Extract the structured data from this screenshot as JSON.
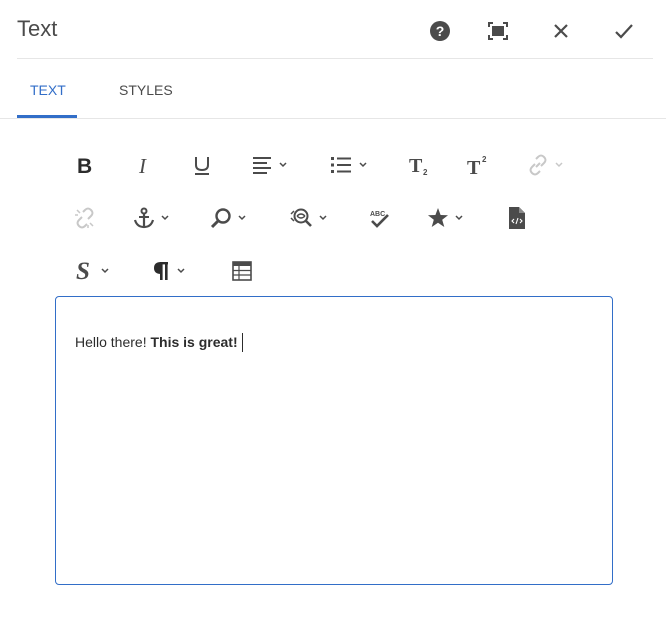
{
  "dialog": {
    "title": "Text",
    "help_icon": "help-icon",
    "fullscreen_icon": "fullscreen-icon",
    "close_icon": "close-icon",
    "confirm_icon": "checkmark-icon"
  },
  "tabs": [
    {
      "label": "TEXT",
      "active": true
    },
    {
      "label": "STYLES",
      "active": false
    }
  ],
  "toolbar": {
    "row1": [
      "bold",
      "italic",
      "underline",
      "align",
      "list",
      "subscript",
      "superscript",
      "link"
    ],
    "row2": [
      "unlink",
      "anchor",
      "find",
      "find-replace",
      "spellcheck",
      "special-characters",
      "source-edit"
    ],
    "row3": [
      "styles",
      "paragraph-format",
      "table"
    ],
    "subscript_label": "T",
    "superscript_label": "T",
    "paragraph_label": "¶",
    "styles_label": "S"
  },
  "editor": {
    "text_plain": "Hello there! ",
    "text_bold": "This is great!"
  },
  "colors": {
    "accent": "#326ec8",
    "icon": "#4b4b4b",
    "disabled_icon": "#c8c8c8"
  }
}
